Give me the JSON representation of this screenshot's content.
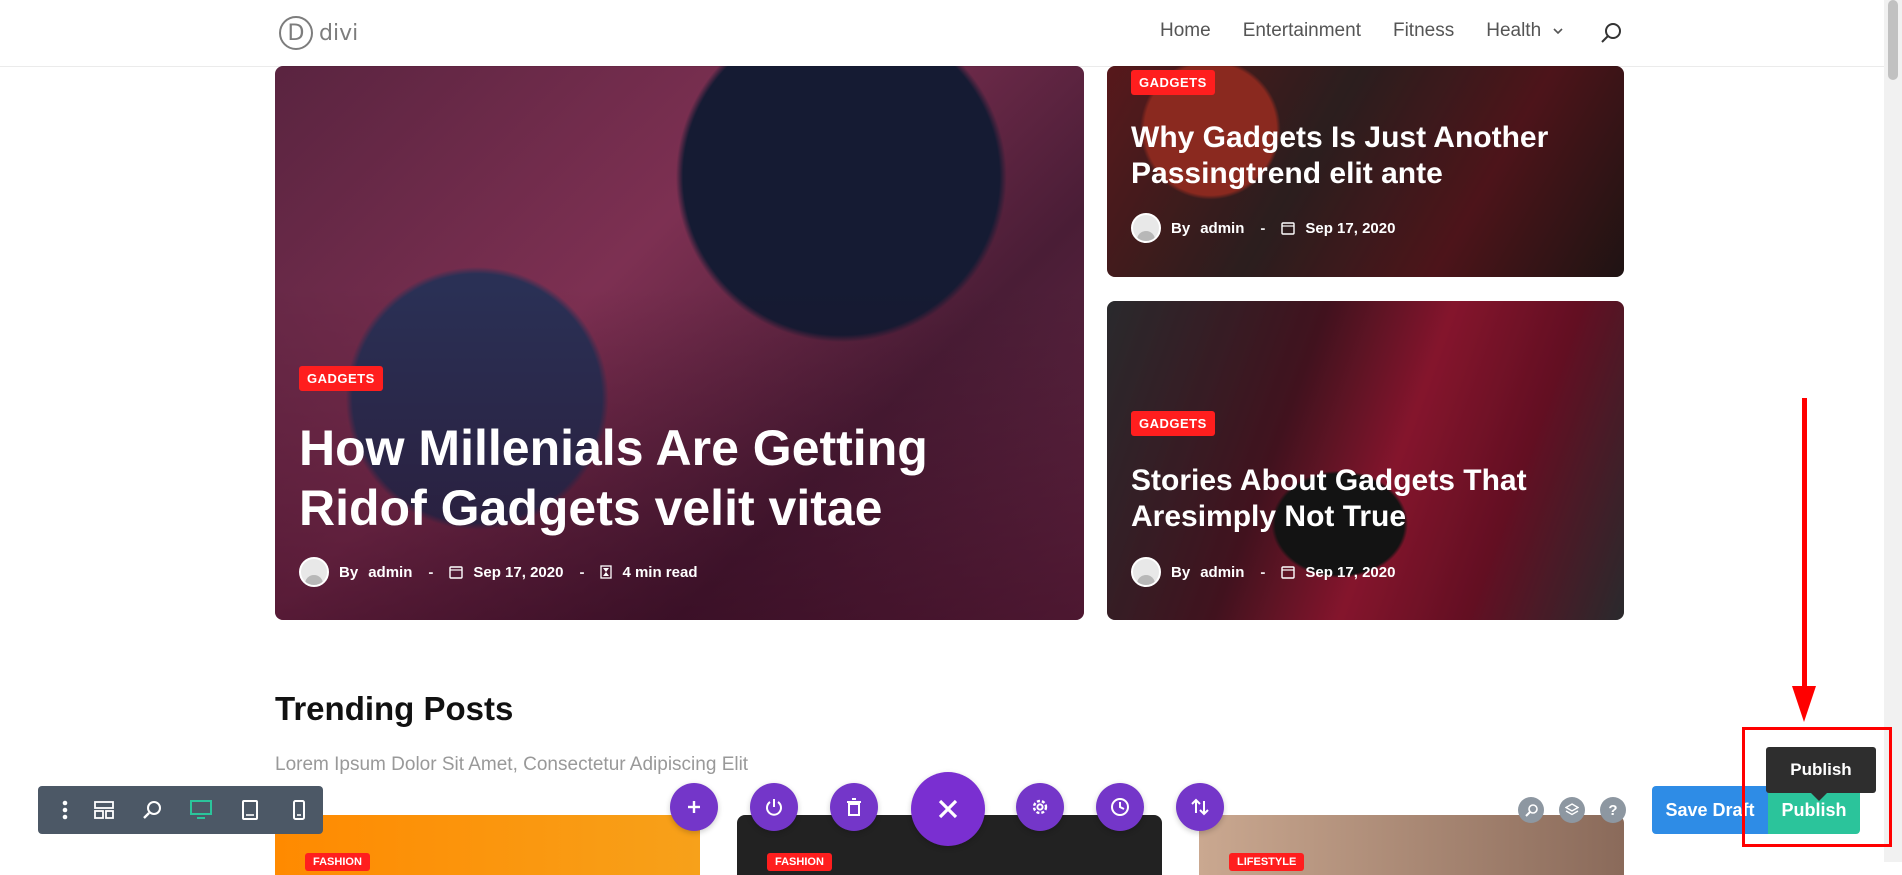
{
  "header": {
    "logo_letter": "D",
    "logo_text": "divi",
    "nav": [
      "Home",
      "Entertainment",
      "Fitness",
      "Health"
    ]
  },
  "hero": {
    "badge": "GADGETS",
    "title": "How Millenials Are Getting Ridof Gadgets velit vitae",
    "author_prefix": "By",
    "author": "admin",
    "sep": "-",
    "date": "Sep 17, 2020",
    "read_time": "4 min read"
  },
  "side_top": {
    "badge": "GADGETS",
    "title": "Why Gadgets Is Just Another Passingtrend elit ante",
    "author_prefix": "By",
    "author": "admin",
    "sep": "-",
    "date": "Sep 17, 2020"
  },
  "side_bottom": {
    "badge": "GADGETS",
    "title": "Stories About Gadgets That Aresimply Not True",
    "author_prefix": "By",
    "author": "admin",
    "sep": "-",
    "date": "Sep 17, 2020"
  },
  "trending": {
    "title": "Trending Posts",
    "subtitle": "Lorem Ipsum Dolor Sit Amet, Consectetur Adipiscing Elit",
    "cards": [
      {
        "badge": "FASHION"
      },
      {
        "badge": "FASHION"
      },
      {
        "badge": "LIFESTYLE"
      }
    ]
  },
  "builder": {
    "help": "?",
    "save_draft": "Save Draft",
    "publish": "Publish",
    "tooltip": "Publish"
  },
  "colors": {
    "badge": "#ff1e1e",
    "builder_purple": "#7436c9",
    "save_draft": "#2e8ce6",
    "publish": "#2bc49b",
    "annotation": "#ff0000"
  }
}
